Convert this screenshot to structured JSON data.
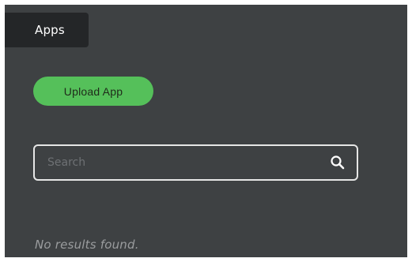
{
  "tab": {
    "label": "Apps"
  },
  "upload_button": {
    "label": "Upload App",
    "color": "#55c05a"
  },
  "search": {
    "placeholder": "Search",
    "value": "",
    "icon": "search-icon"
  },
  "results": {
    "empty_message": "No results found."
  },
  "theme": {
    "panel_bg": "#3e4143",
    "tab_bg": "#242628",
    "accent": "#55c05a"
  }
}
